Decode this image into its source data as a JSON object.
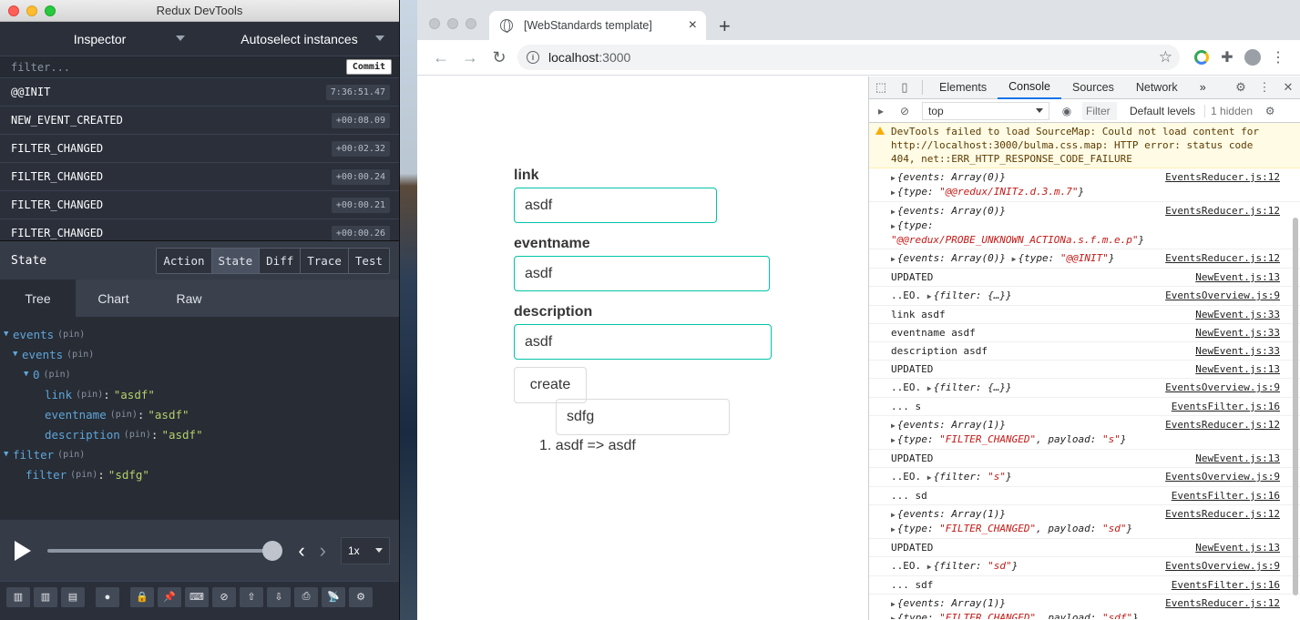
{
  "redux": {
    "window_title": "Redux DevTools",
    "monitor_select": "Inspector",
    "instance_select": "Autoselect instances",
    "filter_placeholder": "filter...",
    "commit_label": "Commit",
    "actions": [
      {
        "name": "@@INIT",
        "time": "7:36:51.47"
      },
      {
        "name": "NEW_EVENT_CREATED",
        "time": "+00:08.09"
      },
      {
        "name": "FILTER_CHANGED",
        "time": "+00:02.32"
      },
      {
        "name": "FILTER_CHANGED",
        "time": "+00:00.24"
      },
      {
        "name": "FILTER_CHANGED",
        "time": "+00:00.21"
      },
      {
        "name": "FILTER_CHANGED",
        "time": "+00:00.26"
      }
    ],
    "state_label": "State",
    "view_tabs": [
      "Action",
      "State",
      "Diff",
      "Trace",
      "Test"
    ],
    "active_view_tab": "State",
    "sub_tabs": [
      "Tree",
      "Chart",
      "Raw"
    ],
    "active_sub_tab": "Tree",
    "tree": {
      "pin": "(pin)",
      "events_root": "events",
      "events_inner": "events",
      "index0": "0",
      "link_key": "link",
      "link_val": "\"asdf\"",
      "eventname_key": "eventname",
      "eventname_val": "\"asdf\"",
      "description_key": "description",
      "description_val": "\"asdf\"",
      "filter_root": "filter",
      "filter_key": "filter",
      "filter_val": "\"sdfg\""
    },
    "speed": "1x",
    "slider_position": 1.0
  },
  "browser": {
    "tab_title": "[WebStandards template]",
    "url_host": "localhost",
    "url_port": ":3000",
    "new_tab": "+",
    "tab_close": "×"
  },
  "page": {
    "link_label": "link",
    "link_value": "asdf",
    "eventname_label": "eventname",
    "eventname_value": "asdf",
    "description_label": "description",
    "description_value": "asdf",
    "create_label": "create",
    "filter_value": "sdfg",
    "events": [
      "1. asdf => asdf"
    ]
  },
  "devtools": {
    "tabs": [
      "Elements",
      "Console",
      "Sources",
      "Network"
    ],
    "active_tab": "Console",
    "more": "»",
    "context": "top",
    "filter_placeholder": "Filter",
    "levels": "Default levels",
    "hidden": "1 hidden",
    "warning": "DevTools failed to load SourceMap: Could not load content for http://localhost:3000/bulma.css.map: HTTP error: status code 404, net::ERR_HTTP_RESPONSE_CODE_FAILURE",
    "logs": [
      {
        "line1_obj": "{events: Array(0)}",
        "line2_pre": "{type: ",
        "line2_str": "\"@@redux/INITz.d.3.m.7\"",
        "line2_post": "}",
        "src": "EventsReducer.js:12"
      },
      {
        "line1_obj": "{events: Array(0)}",
        "line2_pre": "{type: ",
        "line2_str": "\"@@redux/PROBE_UNKNOWN_ACTIONa.s.f.m.e.p\"",
        "line2_post": "}",
        "src": "EventsReducer.js:12"
      }
    ],
    "init_log": {
      "a": "{events: Array(0)}",
      "b_pre": "{type: ",
      "b_str": "\"@@INIT\"",
      "b_post": "}",
      "src": "EventsReducer.js:12"
    },
    "simple": [
      {
        "text": "UPDATED",
        "src": "NewEvent.js:13"
      },
      {
        "text": "..EO. ",
        "obj": "{filter: {…}}",
        "src": "EventsOverview.js:9"
      },
      {
        "text": "link asdf",
        "src": "NewEvent.js:33"
      },
      {
        "text": "eventname asdf",
        "src": "NewEvent.js:33"
      },
      {
        "text": "description asdf",
        "src": "NewEvent.js:33"
      },
      {
        "text": "UPDATED",
        "src": "NewEvent.js:13"
      },
      {
        "text": "..EO. ",
        "obj": "{filter: {…}}",
        "src": "EventsOverview.js:9"
      },
      {
        "text": "... s",
        "src": "EventsFilter.js:16"
      }
    ],
    "filter_logs": [
      {
        "payload": "\"s\"",
        "eo": "\"s\"",
        "next": "... sd"
      },
      {
        "payload": "\"sd\"",
        "eo": "\"sd\"",
        "next": "... sdf"
      },
      {
        "payload": "\"sdf\"",
        "eo": "",
        "next": ""
      }
    ],
    "common": {
      "events1": "{events: Array(1)}",
      "type_pre": "{type: ",
      "type_str": "\"FILTER_CHANGED\"",
      "payload_pre": ", payload: ",
      "close": "}",
      "updated": "UPDATED",
      "eo_pre": "..EO. ",
      "filter_pre": "{filter: ",
      "src_reducer": "EventsReducer.js:12",
      "src_new": "NewEvent.js:13",
      "src_overview": "EventsOverview.js:9",
      "src_filter": "EventsFilter.js:16"
    }
  }
}
